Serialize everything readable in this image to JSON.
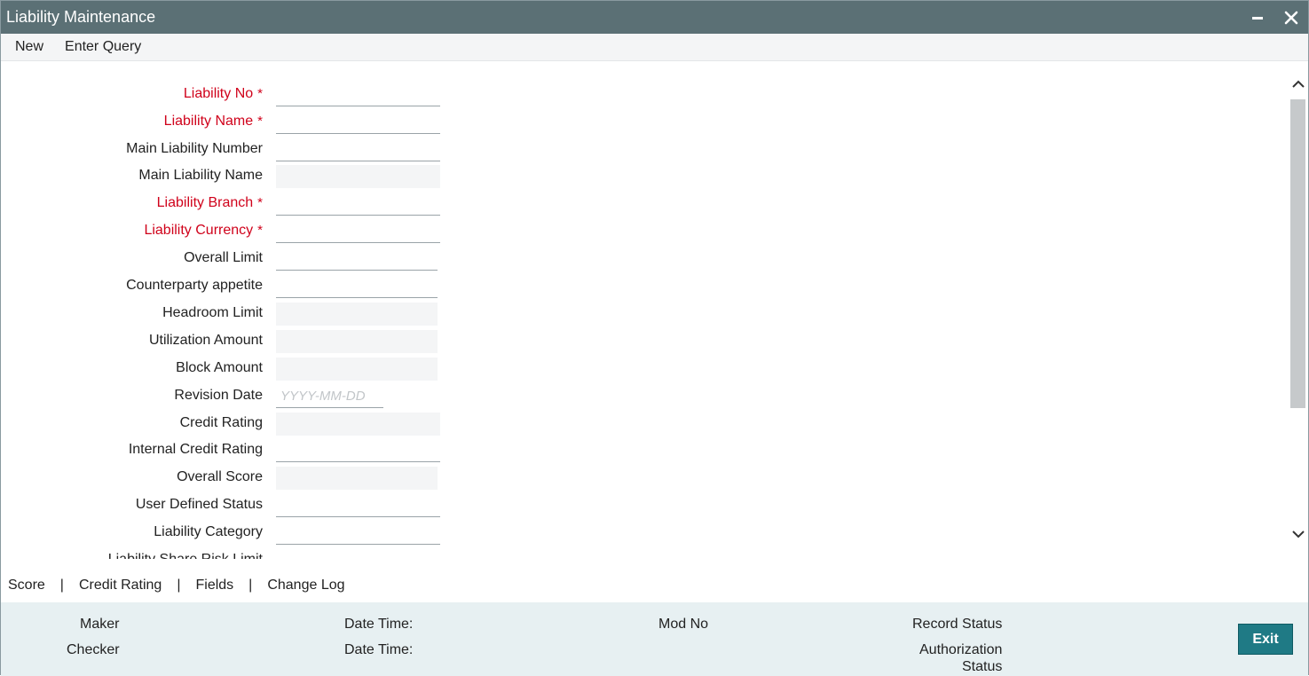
{
  "window": {
    "title": "Liability Maintenance"
  },
  "menu": {
    "new_label": "New",
    "enter_query_label": "Enter Query"
  },
  "form": {
    "fields": [
      {
        "label": "Liability No",
        "required": true,
        "value": "",
        "placeholder": ""
      },
      {
        "label": "Liability Name",
        "required": true,
        "value": "",
        "placeholder": ""
      },
      {
        "label": "Main Liability Number",
        "required": false,
        "value": "",
        "placeholder": ""
      },
      {
        "label": "Main Liability Name",
        "required": false,
        "value": "",
        "placeholder": ""
      },
      {
        "label": "Liability Branch",
        "required": true,
        "value": "",
        "placeholder": ""
      },
      {
        "label": "Liability Currency",
        "required": true,
        "value": "",
        "placeholder": ""
      },
      {
        "label": "Overall Limit",
        "required": false,
        "value": "",
        "placeholder": ""
      },
      {
        "label": "Counterparty appetite",
        "required": false,
        "value": "",
        "placeholder": ""
      },
      {
        "label": "Headroom Limit",
        "required": false,
        "value": "",
        "placeholder": ""
      },
      {
        "label": "Utilization Amount",
        "required": false,
        "value": "",
        "placeholder": ""
      },
      {
        "label": "Block Amount",
        "required": false,
        "value": "",
        "placeholder": ""
      },
      {
        "label": "Revision Date",
        "required": false,
        "value": "",
        "placeholder": "YYYY-MM-DD"
      },
      {
        "label": "Credit Rating",
        "required": false,
        "value": "",
        "placeholder": ""
      },
      {
        "label": "Internal Credit Rating",
        "required": false,
        "value": "",
        "placeholder": ""
      },
      {
        "label": "Overall Score",
        "required": false,
        "value": "",
        "placeholder": ""
      },
      {
        "label": "User Defined Status",
        "required": false,
        "value": "",
        "placeholder": ""
      },
      {
        "label": "Liability Category",
        "required": false,
        "value": "",
        "placeholder": ""
      },
      {
        "label": "Liability Share Risk Limit",
        "required": false,
        "value": "",
        "placeholder": ""
      }
    ],
    "required_marker": "*"
  },
  "subsystems": {
    "score": "Score",
    "credit_rating": "Credit Rating",
    "fields": "Fields",
    "change_log": "Change Log",
    "separator": "|"
  },
  "audit": {
    "maker": "Maker",
    "checker": "Checker",
    "date_time_1": "Date Time:",
    "date_time_2": "Date Time:",
    "mod_no": "Mod No",
    "record_status": "Record Status",
    "authorization_status_1": "Authorization",
    "authorization_status_2": "Status",
    "exit_label": "Exit"
  }
}
